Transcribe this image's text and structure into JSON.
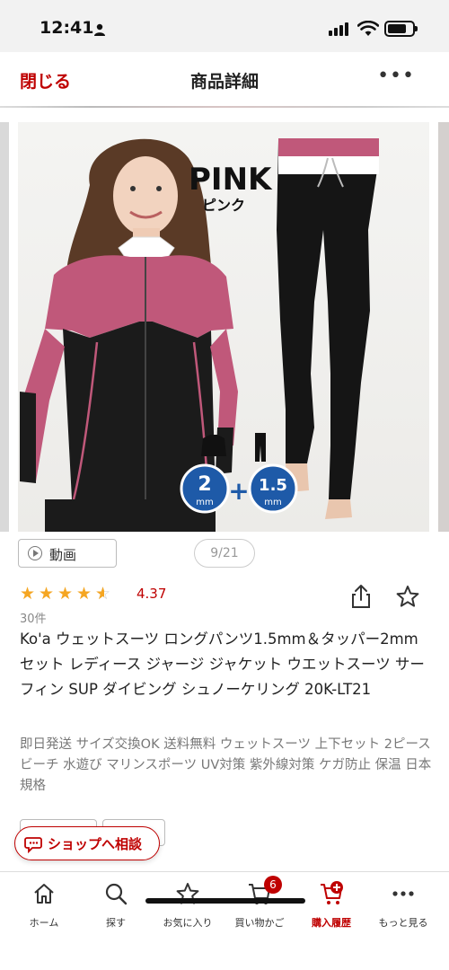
{
  "status_bar": {
    "time": "12:41"
  },
  "header": {
    "close_label": "閉じる",
    "title": "商品詳細",
    "more_label": "•••"
  },
  "gallery": {
    "color_name_en": "PINK",
    "color_name_ja": "ピンク",
    "jacket_thickness": "2",
    "pants_thickness": "1.5",
    "unit": "mm",
    "plus": "+",
    "video_label": "動画",
    "page_counter": "9/21"
  },
  "rating": {
    "value": "4.37",
    "stars": 4.5,
    "review_count": "30件"
  },
  "product": {
    "title": "Ko'a ウェットスーツ ロングパンツ1.5mm＆タッパー2mm セット レディース ジャージ ジャケット ウエットスーツ サーフィン SUP ダイビング シュノーケリング 20K-LT21",
    "description": "即日発送 サイズ交換OK 送料無料 ウェットスーツ 上下セット 2ピース ビーチ 水遊び マリンスポーツ UV対策 紫外線対策 ケガ防止 保温 日本規格"
  },
  "consult_button": {
    "label": "ショップへ相談"
  },
  "tab_bar": {
    "tabs": [
      {
        "label": "ホーム",
        "icon": "home-icon"
      },
      {
        "label": "探す",
        "icon": "search-icon"
      },
      {
        "label": "お気に入り",
        "icon": "star-icon"
      },
      {
        "label": "買い物かご",
        "icon": "cart-icon"
      },
      {
        "label": "購入履歴",
        "icon": "purchase-history-icon"
      },
      {
        "label": "もっと見る",
        "icon": "more-icon"
      }
    ],
    "cart_count": "6",
    "active_tab": "購入履歴"
  },
  "colors": {
    "accent": "#bf0000",
    "star": "#f5a623",
    "pink": "#c0587a"
  }
}
